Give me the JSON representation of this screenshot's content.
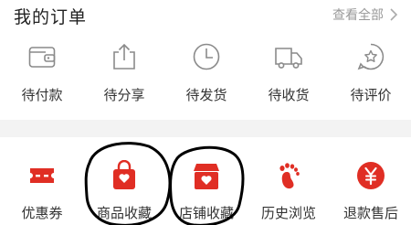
{
  "orders": {
    "title": "我的订单",
    "view_all": "查看全部",
    "items": [
      {
        "label": "待付款",
        "icon": "wallet-icon"
      },
      {
        "label": "待分享",
        "icon": "share-icon"
      },
      {
        "label": "待发货",
        "icon": "clock-icon"
      },
      {
        "label": "待收货",
        "icon": "truck-icon"
      },
      {
        "label": "待评价",
        "icon": "review-icon"
      }
    ]
  },
  "tools": {
    "items": [
      {
        "label": "优惠券",
        "icon": "coupon-icon"
      },
      {
        "label": "商品收藏",
        "icon": "product-favorites-icon"
      },
      {
        "label": "店铺收藏",
        "icon": "shop-favorites-icon"
      },
      {
        "label": "历史浏览",
        "icon": "footprint-icon"
      },
      {
        "label": "退款售后",
        "icon": "refund-icon"
      }
    ]
  },
  "colors": {
    "accent": "#e02e24",
    "outline_icon": "#8a8a8a",
    "annotation": "#000000"
  }
}
